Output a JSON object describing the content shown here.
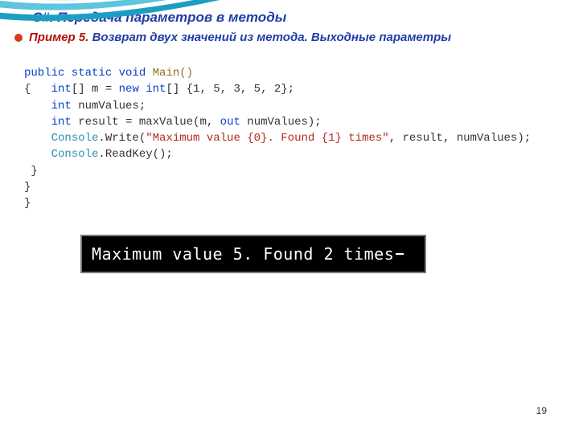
{
  "header": {
    "title": "C#. Передача параметров в методы",
    "subtitle_prefix": "Пример 5.",
    "subtitle_rest": " Возврат двух значений из метода. Выходные параметры"
  },
  "code": {
    "l1": {
      "a": "public static void ",
      "b": "Main()"
    },
    "l2": {
      "a": "{   ",
      "b": "int",
      "c": "[] m = ",
      "d": "new int",
      "e": "[] {1, 5, 3, 5, 2};"
    },
    "l3": {
      "a": "    ",
      "b": "int",
      "c": " numValues;"
    },
    "l4": {
      "a": "    ",
      "b": "int",
      "c": " result = maxValue(m, ",
      "d": "out",
      "e": " numValues);"
    },
    "l5": {
      "a": "    ",
      "b": "Console",
      "c": ".Write(",
      "d": "\"Maximum value {0}. Found {1} times\"",
      "e": ", result, numValues);"
    },
    "l6": {
      "a": "    ",
      "b": "Console",
      "c": ".ReadKey();"
    },
    "l7": " }",
    "l8": "}",
    "l9": "}"
  },
  "console": {
    "output": "Maximum value 5. Found 2 times"
  },
  "page_number": "19"
}
